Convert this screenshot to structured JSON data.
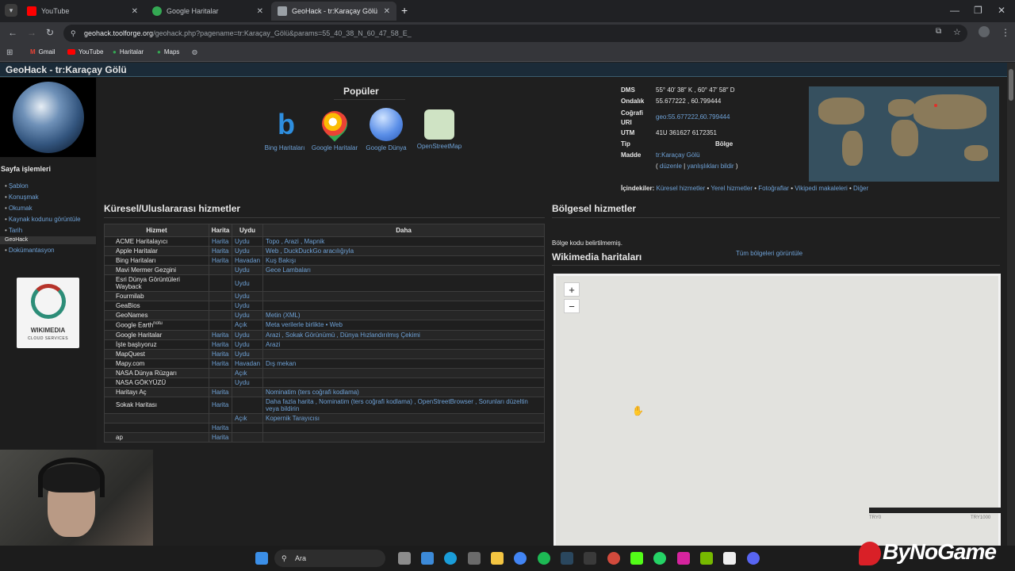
{
  "browser": {
    "tabs": [
      {
        "label": "YouTube",
        "color": "#ff0000"
      },
      {
        "label": "Google Haritalar",
        "color": "#34a853"
      },
      {
        "label": "GeoHack - tr:Karaçay Gölü",
        "color": "#9aa0a6"
      }
    ],
    "new_tab": "+",
    "url_host": "geohack.toolforge.org",
    "url_path": "/geohack.php?pagename=tr:Karaçay_Gölü&params=55_40_38_N_60_47_58_E_",
    "bookmarks": [
      "Gmail",
      "YouTube",
      "Haritalar",
      "Maps"
    ]
  },
  "page": {
    "title": "GeoHack - tr:Karaçay Gölü",
    "sidebar": {
      "heading": "Sayfa işlemleri",
      "links": [
        "Şablon",
        "Konuşmak",
        "Okumak",
        "Kaynak kodunu görüntüle",
        "Tarih"
      ],
      "sub_label": "GeoHack",
      "sub_link": "Dokümantasyon",
      "badge_title": "WIKIMEDIA",
      "badge_sub": "CLOUD SERVICES"
    },
    "popular": {
      "title": "Popüler",
      "items": [
        "Bing Haritaları",
        "Google Haritalar",
        "Google Dünya",
        "OpenStreetMap"
      ]
    },
    "coords": {
      "dms_label": "DMS",
      "dms": "55° 40′ 38″ K , 60° 47′ 58″ D",
      "decimal_label": "Ondalık",
      "decimal": "55.677222 , 60.799444",
      "geo_label_1": "Coğrafi",
      "geo_label_2": "URI",
      "geo": "geo:55.677222,60.799444",
      "utm_label": "UTM",
      "utm": "41U 361627 6172351",
      "type_label": "Tip",
      "region_label": "Bölge",
      "article_label": "Madde",
      "article": "tr:Karaçay Gölü",
      "edit_link": "düzenle",
      "report_link": "yanlışlıkları bildir"
    },
    "contents": {
      "label": "İçindekiler:",
      "items": [
        "Küresel hizmetler",
        "Yerel hizmetler",
        "Fotoğraflar",
        "Vikipedi makaleleri",
        "Diğer"
      ]
    },
    "global_title": "Küresel/Uluslararası hizmetler",
    "table_headers": [
      "Hizmet",
      "Harita",
      "Uydu",
      "Daha"
    ],
    "services": [
      {
        "name": "ACME Haritalayıcı",
        "map": "Harita",
        "sat": "Uydu",
        "more": "Topo , Arazi , Mapnik"
      },
      {
        "name": "Apple Haritalar",
        "map": "Harita",
        "sat": "Uydu",
        "more": "Web , DuckDuckGo aracılığıyla"
      },
      {
        "name": "Bing Haritaları",
        "map": "Harita",
        "sat": "Havadan",
        "more": "Kuş Bakışı"
      },
      {
        "name": "Mavi Mermer Gezgini",
        "map": "",
        "sat": "Uydu",
        "more": "Gece Lambaları"
      },
      {
        "name": "Esri Dünya Görüntüleri Wayback",
        "map": "",
        "sat": "Uydu",
        "more": ""
      },
      {
        "name": "Fourmilab",
        "map": "",
        "sat": "Uydu",
        "more": ""
      },
      {
        "name": "GeaBios",
        "map": "",
        "sat": "Uydu",
        "more": ""
      },
      {
        "name": "GeoNames",
        "map": "",
        "sat": "Uydu",
        "more": "Metin (XML)"
      },
      {
        "name": "Google Earth",
        "map": "",
        "sat": "Açık",
        "more": "Meta verilerle birlikte • Web"
      },
      {
        "name": "Google Haritalar",
        "map": "Harita",
        "sat": "Uydu",
        "more": "Arazi , Sokak Görünümü , Dünya Hızlandırılmış Çekimi"
      },
      {
        "name": "İşte başlıyoruz",
        "map": "Harita",
        "sat": "Uydu",
        "more": "Arazi"
      },
      {
        "name": "MapQuest",
        "map": "Harita",
        "sat": "Uydu",
        "more": ""
      },
      {
        "name": "Mapy.com",
        "map": "Harita",
        "sat": "Havadan",
        "more": "Dış mekan"
      },
      {
        "name": "NASA Dünya Rüzgarı",
        "map": "",
        "sat": "Açık",
        "more": ""
      },
      {
        "name": "NASA GÖKYÜZÜ",
        "map": "",
        "sat": "Uydu",
        "more": ""
      },
      {
        "name": "Haritayı Aç",
        "map": "Harita",
        "sat": "",
        "more": "Nominatim (ters coğrafi kodlama)"
      },
      {
        "name": "Sokak Haritası",
        "map": "Harita",
        "sat": "",
        "more": "Daha fazla harita , Nominatim (ters coğrafi kodlama) , OpenStreetBrowser , Sorunları düzeltin veya bildirin"
      },
      {
        "name": "",
        "map": "",
        "sat": "Açık",
        "more": "Kopernik Tarayıcısı"
      },
      {
        "name": "",
        "map": "Harita",
        "sat": "",
        "more": ""
      },
      {
        "name": "ap",
        "map": "Harita",
        "sat": "",
        "more": ""
      }
    ],
    "google_earth_note": "notu",
    "regional_title": "Bölgesel hizmetler",
    "region_note": "Bölge kodu belirtilmemiş.",
    "region_link": "Tüm bölgeleri görüntüle",
    "wikimedia_title": "Wikimedia haritaları",
    "zoom_in": "+",
    "zoom_out": "−",
    "scale_left": "TRY0",
    "scale_right": "TRY1000"
  },
  "taskbar": {
    "search_placeholder": "Ara"
  },
  "watermark": "ByNoGame"
}
